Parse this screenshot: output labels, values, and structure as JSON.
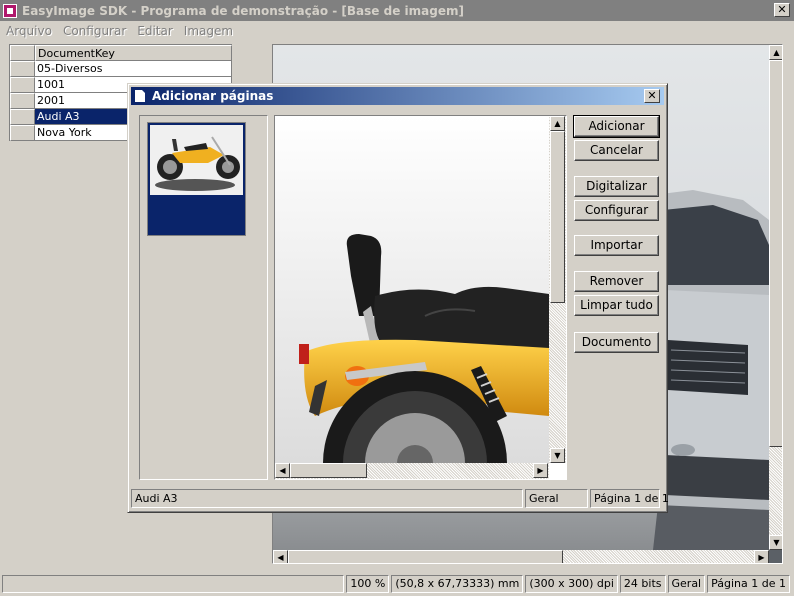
{
  "window": {
    "title": "EasyImage SDK - Programa de demonstração - [Base de imagem]",
    "close_glyph": "✕"
  },
  "menu": [
    "Arquivo",
    "Configurar",
    "Editar",
    "Imagem"
  ],
  "grid": {
    "header": "DocumentKey",
    "rows": [
      "05-Diversos",
      "1001",
      "2001",
      "Audi A3",
      "Nova York"
    ],
    "selected_row": "Audi A3"
  },
  "statusbar": [
    "100 %",
    "(50,8 x 67,73333) mm",
    "(300 x 300) dpi",
    "24 bits",
    "Geral",
    "Página 1 de 1"
  ],
  "dialog": {
    "title": "Adicionar páginas",
    "close_glyph": "✕",
    "buttons": {
      "adicionar": "Adicionar",
      "cancelar": "Cancelar",
      "digitalizar": "Digitalizar",
      "configurar": "Configurar",
      "importar": "Importar",
      "remover": "Remover",
      "limpar": "Limpar tudo",
      "documento": "Documento"
    },
    "status": [
      "Audi A3",
      "Geral",
      "Página 1 de 1"
    ]
  },
  "scroll_glyphs": {
    "up": "▲",
    "down": "▼",
    "left": "◀",
    "right": "▶"
  },
  "colors": {
    "selection": "#0a246a",
    "face": "#d4d0c8",
    "moto_yellow": "#f0b020"
  }
}
